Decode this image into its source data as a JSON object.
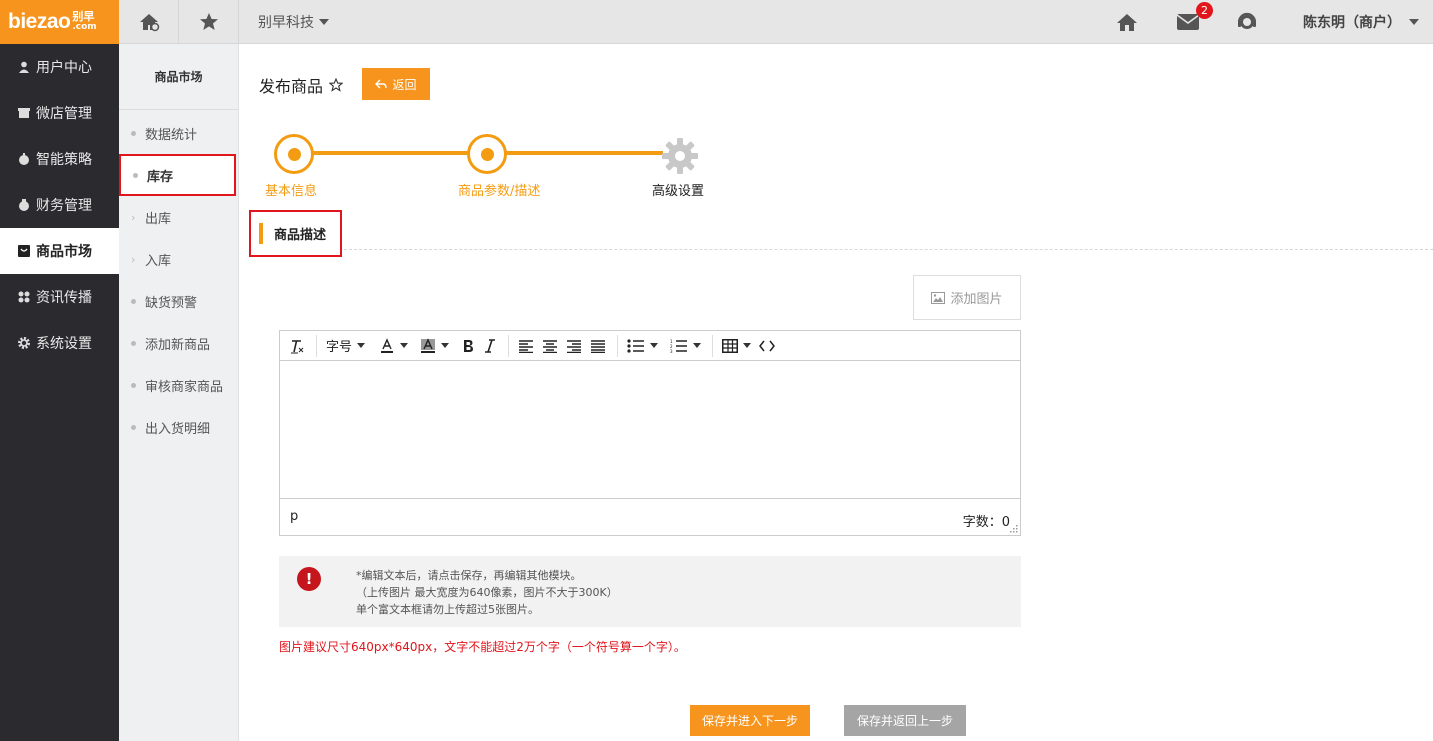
{
  "brand": {
    "logo_text": "biezao",
    "logo_cn": "别早",
    "logo_suffix": ".com"
  },
  "topbar": {
    "company": "别早科技",
    "mail_badge": "2",
    "user": "陈东明（商户）"
  },
  "leftnav": {
    "items": [
      {
        "label": "用户中心",
        "icon": "user-icon"
      },
      {
        "label": "微店管理",
        "icon": "store-icon"
      },
      {
        "label": "智能策略",
        "icon": "strategy-icon"
      },
      {
        "label": "财务管理",
        "icon": "money-icon"
      },
      {
        "label": "商品市场",
        "icon": "market-icon",
        "active": true
      },
      {
        "label": "资讯传播",
        "icon": "grid-icon"
      },
      {
        "label": "系统设置",
        "icon": "gear-icon"
      }
    ]
  },
  "subnav": {
    "title": "商品市场",
    "items": [
      {
        "label": "数据统计"
      },
      {
        "label": "库存",
        "selected": true
      },
      {
        "label": "出库"
      },
      {
        "label": "入库"
      },
      {
        "label": "缺货预警"
      },
      {
        "label": "添加新商品"
      },
      {
        "label": "审核商家商品"
      },
      {
        "label": "出入货明细"
      }
    ]
  },
  "page": {
    "title": "发布商品",
    "back_label": "返回"
  },
  "steps": [
    {
      "label": "基本信息",
      "state": "done"
    },
    {
      "label": "商品参数/描述",
      "state": "current"
    },
    {
      "label": "高级设置",
      "state": "pending"
    }
  ],
  "section": {
    "title": "商品描述"
  },
  "editor": {
    "add_image_label": "添加图片",
    "toolbar": {
      "font_size_label": "字号"
    },
    "status_path": "p",
    "word_count": "字数：0"
  },
  "notice": {
    "lines": [
      "*编辑文本后，请点击保存，再编辑其他模块。",
      "（上传图片 最大宽度为640像素，图片不大于300K）",
      "单个富文本框请勿上传超过5张图片。"
    ],
    "hint": "图片建议尺寸640px*640px，文字不能超过2万个字（一个符号算一个字）。"
  },
  "actions": {
    "next_label": "保存并进入下一步",
    "prev_label": "保存并返回上一步"
  },
  "colors": {
    "accent": "#f7941d",
    "step": "#f39c12",
    "sidebar": "#2b2b2f",
    "alert": "#e0161c"
  }
}
